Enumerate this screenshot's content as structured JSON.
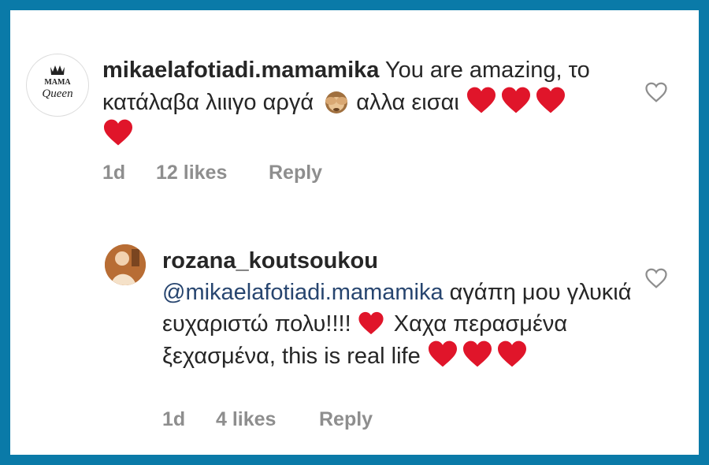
{
  "comments": [
    {
      "username": "mikaelafotiadi.mamamika",
      "avatar_text": [
        "MAMA",
        "Queen"
      ],
      "text_part1": " You are amazing, το κατάλαβα λιιιγο αργά ",
      "text_part2": " αλλα εισαι ",
      "hearts": 4,
      "age": "1d",
      "likes": "12 likes",
      "reply": "Reply"
    },
    {
      "username": "rozana_koutsoukou",
      "mention": "@mikaelafotiadi.mamamika",
      "text_part1": " αγάπη μου γλυκιά ευχαριστώ πολυ!!!! ",
      "text_part2": " Χαχα περασμένα ξεχασμένα, this is real life ",
      "hearts_end": 3,
      "age": "1d",
      "likes": "4 likes",
      "reply": "Reply"
    }
  ],
  "colors": {
    "frame_border": "#0a7aa8",
    "heart": "#e0152a",
    "meta": "#8e8e8e",
    "mention": "#27456f"
  },
  "icons": [
    "heart-outline-icon",
    "heart-emoji-icon",
    "see-no-evil-monkey-emoji-icon"
  ]
}
